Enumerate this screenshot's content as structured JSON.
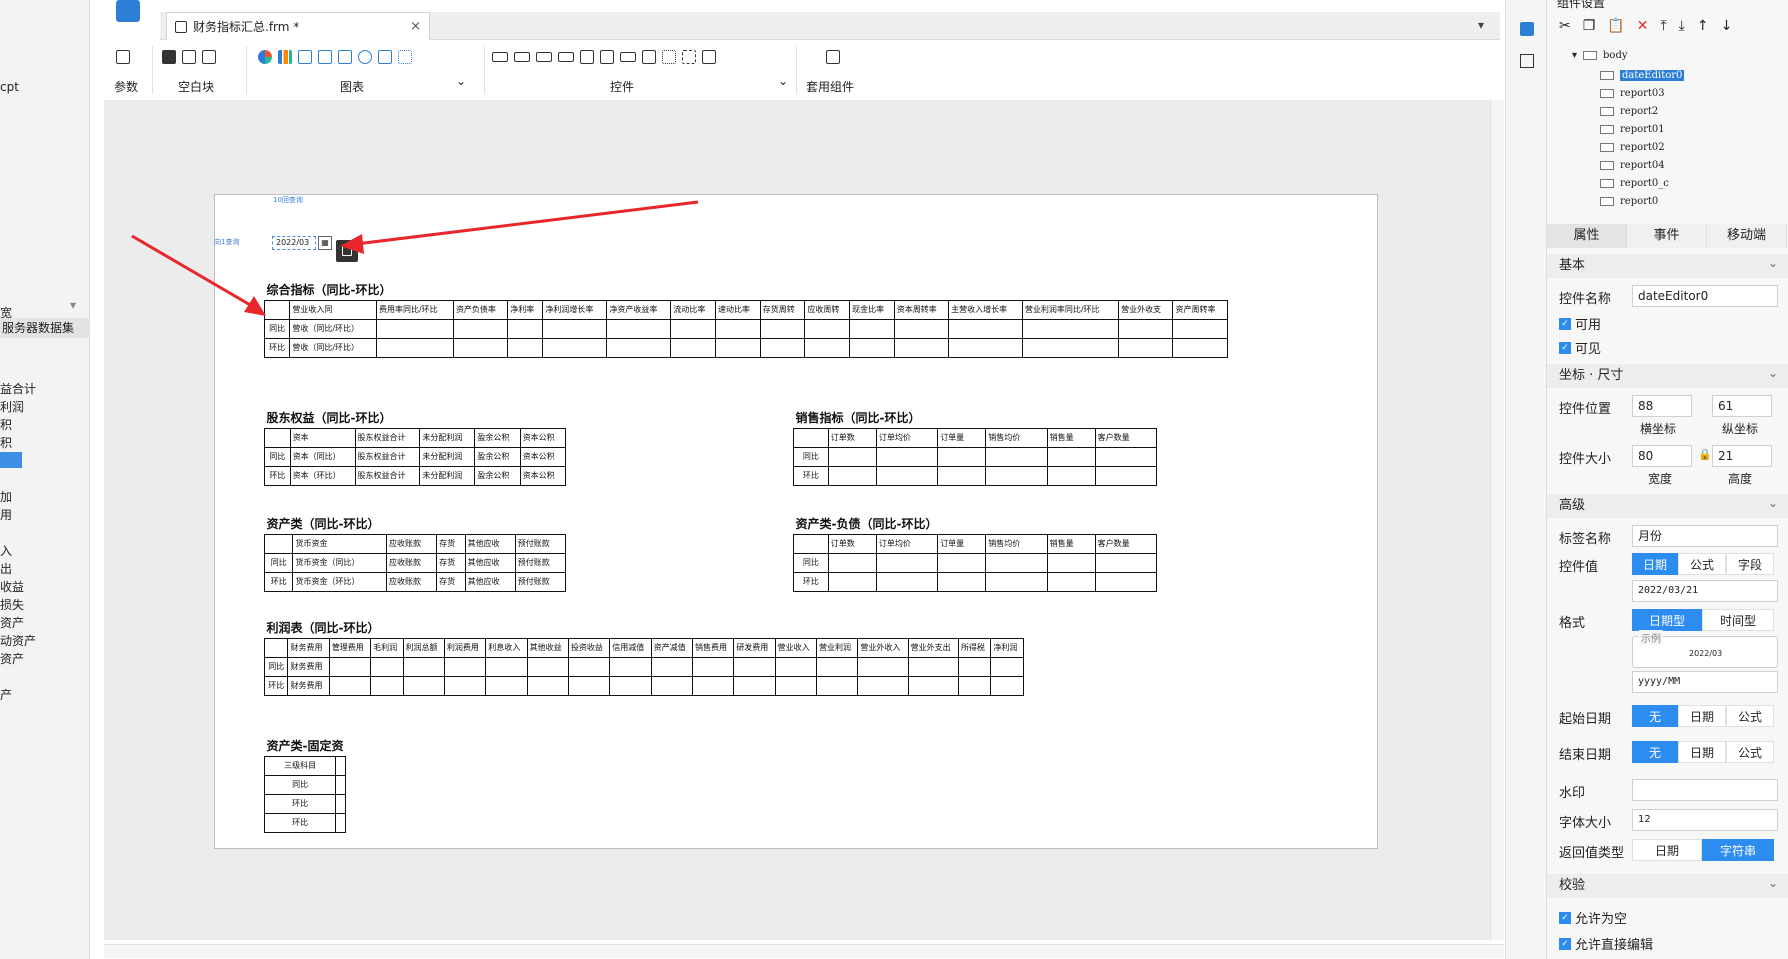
{
  "window": {
    "tab_title": "财务指标汇总.frm *",
    "close_glyph": "×"
  },
  "left_panel": {
    "top_label": "cpt",
    "header": "服务器数据集",
    "items": [
      "益合计",
      "利润",
      "积",
      "积",
      "加",
      "用",
      "入",
      "出",
      "收益",
      "损失",
      "资产",
      "动资产",
      "资产",
      "产"
    ],
    "top_item": "宽"
  },
  "ribbon": {
    "groups": [
      {
        "label": "参数"
      },
      {
        "label": "空白块"
      },
      {
        "label": "图表"
      },
      {
        "label": "控件"
      },
      {
        "label": "套用组件"
      }
    ],
    "dropdown_glyph": "⌄"
  },
  "canvas": {
    "tiny_label_top": "10回查询",
    "tiny_label_left": "向1查询",
    "date_value": "2022/03",
    "sections": {
      "zonghe": {
        "title": "综合指标（同比-环比）",
        "headers": [
          "营业收入同",
          "费用率同比/环比",
          "资产负债率",
          "净利率",
          "净利润增长率",
          "净资产收益率",
          "流动比率",
          "速动比率",
          "存货周转",
          "应收周转",
          "现金比率",
          "资本周转率",
          "主营收入增长率",
          "营业利润率同比/环比",
          "营业外收支",
          "资产周转率"
        ],
        "rows": [
          {
            "label": "同比",
            "val": "营收（同比/环比）"
          },
          {
            "label": "环比",
            "val": "营收（同比/环比）"
          }
        ]
      },
      "gudong": {
        "title": "股东权益（同比-环比）",
        "headers": [
          "资本",
          "股东权益合计",
          "未分配利润",
          "盈余公积",
          "资本公积"
        ],
        "rows": [
          {
            "label": "同比",
            "vals": [
              "资本（同比）",
              "股东权益合计",
              "未分配利润",
              "盈余公积",
              "资本公积"
            ]
          },
          {
            "label": "环比",
            "vals": [
              "资本（环比）",
              "股东权益合计",
              "未分配利润",
              "盈余公积",
              "资本公积"
            ]
          }
        ]
      },
      "xiaoshou": {
        "title": "销售指标（同比-环比）",
        "headers": [
          "订单数",
          "订单均价",
          "订单量",
          "销售均价",
          "销售量",
          "客户数量"
        ],
        "rows": [
          {
            "label": "同比"
          },
          {
            "label": "环比"
          }
        ]
      },
      "zichan": {
        "title": "资产类（同比-环比）",
        "headers": [
          "货币资金",
          "应收账款",
          "存货",
          "其他应收",
          "预付账款"
        ],
        "rows": [
          {
            "label": "同比",
            "vals": [
              "货币资金（同比）",
              "应收账款",
              "存货",
              "其他应收",
              "预付账款"
            ]
          },
          {
            "label": "环比",
            "vals": [
              "货币资金（环比）",
              "应收账款",
              "存货",
              "其他应收",
              "预付账款"
            ]
          }
        ]
      },
      "fuzhai": {
        "title": "资产类-负债（同比-环比）",
        "headers": [
          "订单数",
          "订单均价",
          "订单量",
          "销售均价",
          "销售量",
          "客户数量"
        ],
        "rows": [
          {
            "label": "同比"
          },
          {
            "label": "环比"
          }
        ]
      },
      "lirun": {
        "title": "利润表（同比-环比）",
        "headers": [
          "财务费用",
          "管理费用",
          "毛利润",
          "利润总额",
          "利润费用",
          "利息收入",
          "其他收益",
          "投资收益",
          "信用减值",
          "资产减值",
          "销售费用",
          "研发费用",
          "营业收入",
          "营业利润",
          "营业外收入",
          "营业外支出",
          "所得税",
          "净利润"
        ],
        "rows": [
          {
            "label": "同比",
            "val": "财务费用"
          },
          {
            "label": "环比",
            "val": "财务费用"
          }
        ]
      },
      "guding": {
        "title": "资产类-固定资",
        "rows": [
          "三级科目",
          "同比",
          "环比",
          "环比"
        ]
      }
    }
  },
  "right_panel": {
    "title": "组件设置",
    "tree": {
      "root": "body",
      "items": [
        "dateEditor0",
        "report03",
        "report2",
        "report01",
        "report02",
        "report04",
        "report0_c",
        "report0"
      ],
      "selected": "dateEditor0"
    },
    "tabs": [
      "属性",
      "事件",
      "移动端"
    ],
    "basic": {
      "section": "基本",
      "name_label": "控件名称",
      "name_value": "dateEditor0",
      "enabled": "可用",
      "visible": "可见"
    },
    "geom": {
      "section": "坐标 · 尺寸",
      "pos_label": "控件位置",
      "x_value": "88",
      "y_value": "61",
      "x_caption": "横坐标",
      "y_caption": "纵坐标",
      "size_label": "控件大小",
      "w_value": "80",
      "h_value": "21",
      "w_caption": "宽度",
      "h_caption": "高度"
    },
    "advanced": {
      "section": "高级",
      "tag_label": "标签名称",
      "tag_value": "月份",
      "value_label": "控件值",
      "value_modes": [
        "日期",
        "公式",
        "字段"
      ],
      "value_date": "2022/03/21",
      "format_label": "格式",
      "format_modes": [
        "日期型",
        "时间型"
      ],
      "example_legend": "示例",
      "example_value": "2022/03",
      "pattern": "yyyy/MM",
      "start_label": "起始日期",
      "start_modes": [
        "无",
        "日期",
        "公式"
      ],
      "end_label": "结束日期",
      "end_modes": [
        "无",
        "日期",
        "公式"
      ],
      "watermark_label": "水印",
      "font_label": "字体大小",
      "font_value": "12",
      "return_label": "返回值类型",
      "return_modes": [
        "日期",
        "字符串"
      ]
    },
    "validate": {
      "section": "校验",
      "allow_empty": "允许为空",
      "allow_direct": "允许直接编辑"
    }
  },
  "colors": {
    "accent": "#2d8cf0",
    "arrow": "#e8262b"
  }
}
